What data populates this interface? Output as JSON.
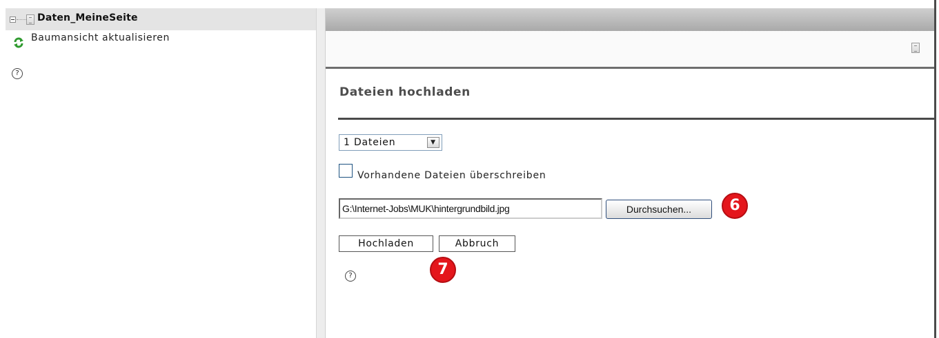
{
  "tree": {
    "root_label": "Daten_MeineSeite",
    "refresh_label": "Baumansicht aktualisieren",
    "help_glyph": "?"
  },
  "content": {
    "title": "Dateien hochladen",
    "file_count_select": {
      "value": "1 Dateien",
      "arrow": "▼"
    },
    "overwrite_checkbox": {
      "label": "Vorhandene Dateien überschreiben",
      "checked": false
    },
    "file_input": {
      "value": "G:\\Internet-Jobs\\MUK\\hintergrundbild.jpg"
    },
    "browse_button": "Durchsuchen...",
    "upload_button": "Hochladen",
    "cancel_button": "Abbruch",
    "help_glyph": "?"
  },
  "annotations": {
    "marker_6": "6",
    "marker_7": "7",
    "color": "#e4161c"
  },
  "icons": [
    "collapse-icon",
    "document-icon",
    "refresh-icon",
    "help-icon"
  ]
}
